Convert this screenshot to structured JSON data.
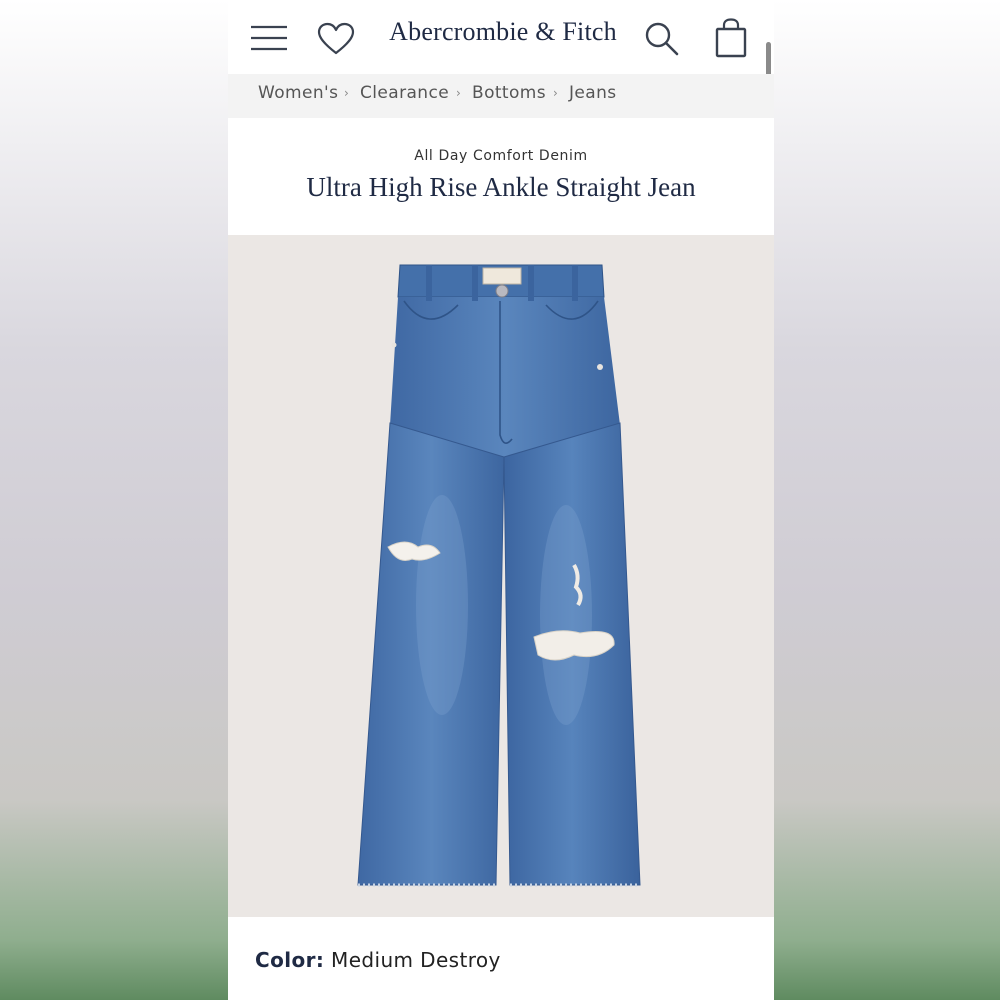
{
  "header": {
    "brand": "Abercrombie & Fitch",
    "menu_icon": "hamburger-menu-icon",
    "wishlist_icon": "heart-icon",
    "search_icon": "search-icon",
    "bag_icon": "shopping-bag-icon"
  },
  "breadcrumb": {
    "items": [
      "Women's",
      "Clearance",
      "Bottoms",
      "Jeans"
    ],
    "separator": "›"
  },
  "product": {
    "collection": "All Day Comfort Denim",
    "title": "Ultra High Rise Ankle Straight Jean",
    "image_alt": "jeans-product-image",
    "color_label": "Color:",
    "color_value": "Medium Destroy"
  },
  "colors": {
    "brand_navy": "#1f2a44",
    "breadcrumb_bg": "#f3f3f3",
    "image_bg": "#ebe7e4",
    "denim": "#4a74ad"
  }
}
